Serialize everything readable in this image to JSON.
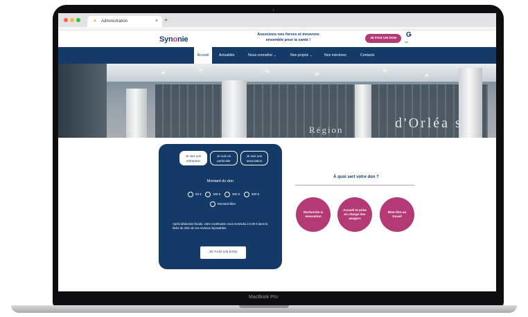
{
  "device": {
    "label": "MacBook Pro"
  },
  "browser": {
    "tab_title": "Administration",
    "tab_close": "×",
    "new_tab": "+"
  },
  "site": {
    "logo_prefix": "Syn",
    "logo_o": "o",
    "logo_suffix": "nie",
    "tagline_line1": "Associons nos forces et innovons",
    "tagline_line2": "ensemble pour la santé !",
    "donate_top": "JE FAIS UN DON",
    "partner_mark": "Ǥ",
    "partner_text": "chr"
  },
  "nav": {
    "items": [
      {
        "label": "Accueil"
      },
      {
        "label": "Actualités"
      },
      {
        "label": "Nous connaître ⌄"
      },
      {
        "label": "Nos projets ⌄"
      },
      {
        "label": "Nos mécènes"
      },
      {
        "label": "Contacts"
      }
    ]
  },
  "hero": {
    "region_text": "Région",
    "city_text": "d'Orléa s"
  },
  "donation": {
    "who": [
      {
        "line1": "Je suis une",
        "line2": "entreprise",
        "selected": true
      },
      {
        "line1": "Je suis un",
        "line2": "particulier",
        "selected": false
      },
      {
        "line1": "Je suis une",
        "line2": "association",
        "selected": false
      }
    ],
    "amount_title": "Montant du don",
    "amounts": [
      "50 €",
      "100 €",
      "300 €",
      "500 €"
    ],
    "free_amount": "Montant libre",
    "note": "Après déduction fiscale, votre contribution vous reviendra à 0,00 € dans la limite de 20% de vos revenus imposables.",
    "submit": "JE FAIS UN DON"
  },
  "purpose": {
    "title": "À quoi sert votre don ?",
    "items": [
      {
        "label": "Recherche & innovation"
      },
      {
        "label": "Accueil et prise en charge des usagers"
      },
      {
        "label": "Bien-être au travail"
      }
    ]
  }
}
